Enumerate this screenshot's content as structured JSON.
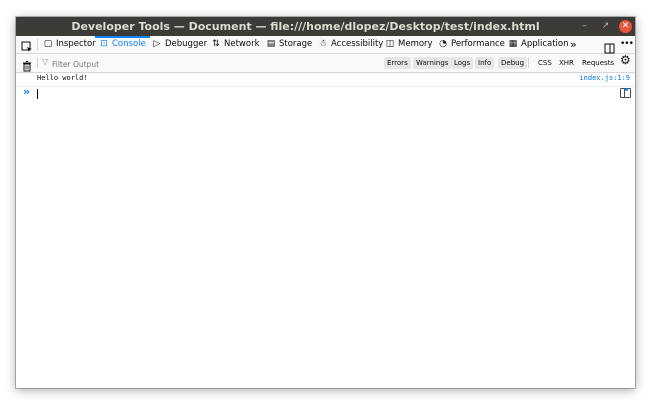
{
  "window": {
    "title": "Developer Tools — Document — file:///home/dlopez/Desktop/test/index.html"
  },
  "tabs": [
    {
      "label": "Inspector",
      "icon": "inspector-icon"
    },
    {
      "label": "Console",
      "icon": "console-icon",
      "selected": true
    },
    {
      "label": "Debugger",
      "icon": "debugger-icon"
    },
    {
      "label": "Network",
      "icon": "network-icon"
    },
    {
      "label": "Storage",
      "icon": "storage-icon"
    },
    {
      "label": "Accessibility",
      "icon": "accessibility-icon"
    },
    {
      "label": "Memory",
      "icon": "memory-icon"
    },
    {
      "label": "Performance",
      "icon": "performance-icon"
    },
    {
      "label": "Application",
      "icon": "application-icon"
    }
  ],
  "toolbar": {
    "filter_placeholder": "Filter Output",
    "levels": [
      "Errors",
      "Warnings",
      "Logs",
      "Info",
      "Debug"
    ],
    "requests": [
      "CSS",
      "XHR",
      "Requests"
    ]
  },
  "console": {
    "messages": [
      {
        "text": "Hello world!",
        "location": "index.js:1:9"
      }
    ]
  },
  "colors": {
    "accent": "#0a84ff",
    "titlebar": "#3c3b37",
    "close": "#e8553d"
  }
}
